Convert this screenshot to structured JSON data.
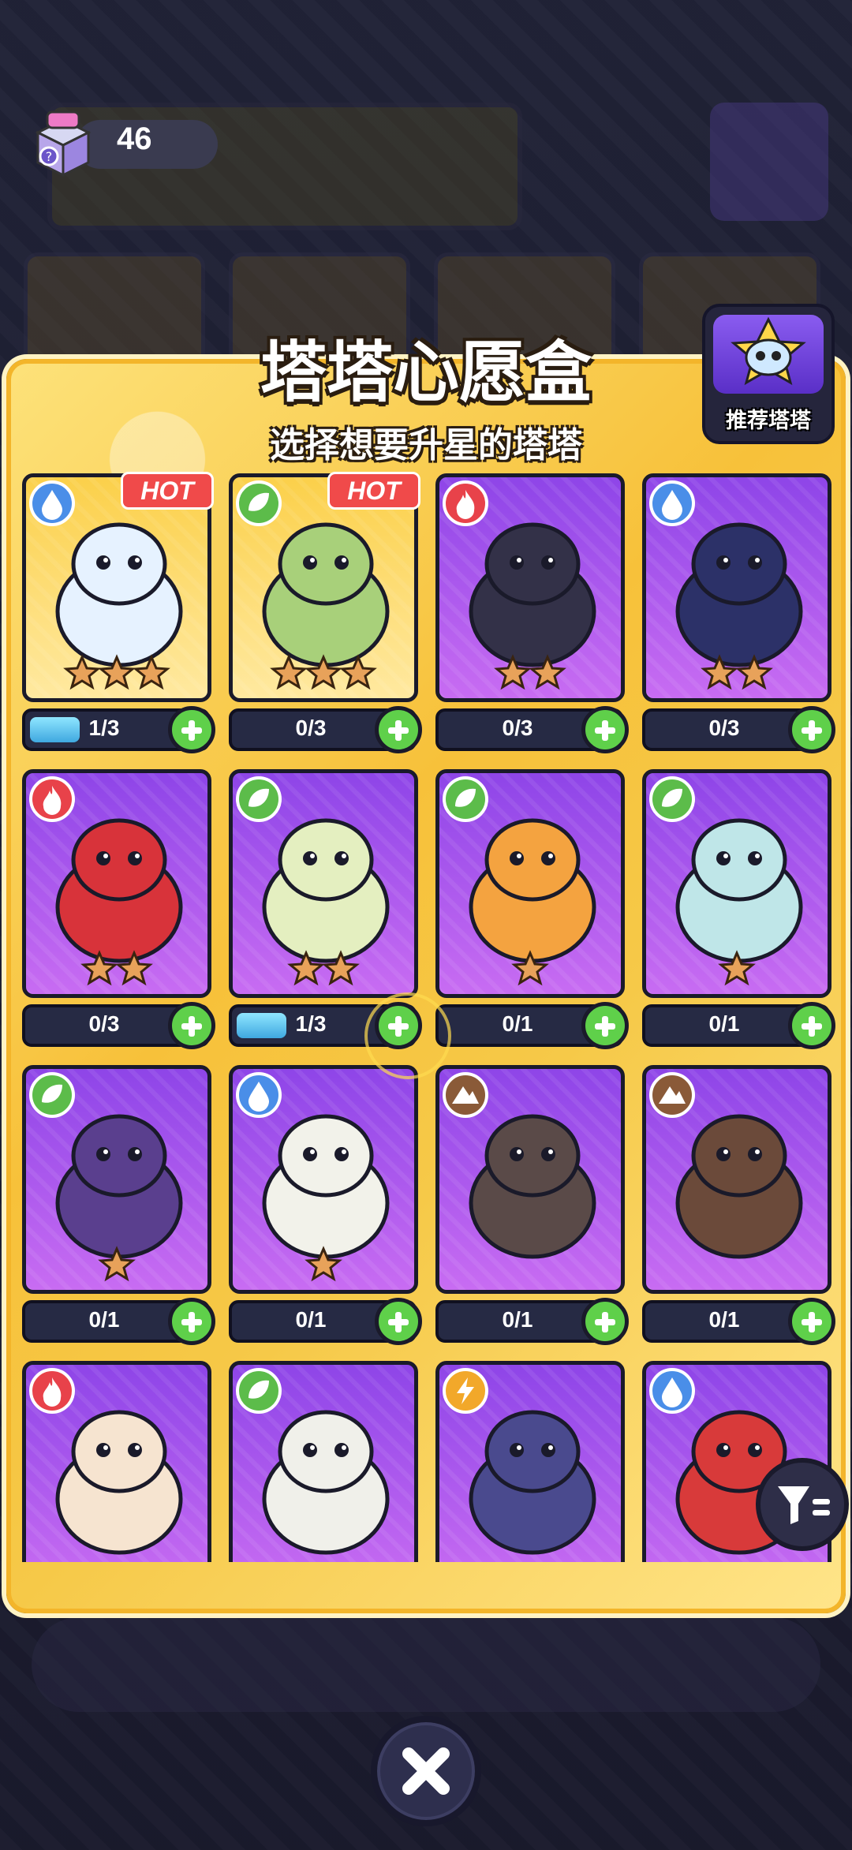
{
  "currency": {
    "value": "46",
    "icon": "gift-box-icon"
  },
  "panel": {
    "title": "塔塔心愿盒",
    "subtitle": "选择想要升星的塔塔",
    "recommend_label": "推荐塔塔"
  },
  "cards": [
    {
      "element": "water",
      "bg": "gold",
      "hot": true,
      "stars": 3,
      "progress": "1/3",
      "fill": 0.333,
      "creature": "blue-white-cat"
    },
    {
      "element": "grass",
      "bg": "gold",
      "hot": true,
      "stars": 3,
      "progress": "0/3",
      "fill": 0,
      "creature": "green-dragonfruit-cat"
    },
    {
      "element": "fire",
      "bg": "purple",
      "hot": false,
      "stars": 2,
      "progress": "0/3",
      "fill": 0,
      "creature": "dark-shiba-dog"
    },
    {
      "element": "water",
      "bg": "purple",
      "hot": false,
      "stars": 2,
      "progress": "0/3",
      "fill": 0,
      "creature": "rockhopper-penguin"
    },
    {
      "element": "fire",
      "bg": "purple",
      "hot": false,
      "stars": 2,
      "progress": "0/3",
      "fill": 0,
      "creature": "red-boxing-bird"
    },
    {
      "element": "grass",
      "bg": "purple",
      "hot": false,
      "stars": 2,
      "progress": "1/3",
      "fill": 0.333,
      "creature": "leaf-chicken"
    },
    {
      "element": "grass",
      "bg": "purple",
      "hot": false,
      "stars": 1,
      "progress": "0/1",
      "fill": 0,
      "creature": "sunflower"
    },
    {
      "element": "grass",
      "bg": "purple",
      "hot": false,
      "stars": 1,
      "progress": "0/1",
      "fill": 0,
      "creature": "slime-jar-bug"
    },
    {
      "element": "grass",
      "bg": "purple",
      "hot": false,
      "stars": 1,
      "progress": "0/1",
      "fill": 0,
      "creature": "mushroom"
    },
    {
      "element": "water",
      "bg": "purple",
      "hot": false,
      "stars": 1,
      "progress": "0/1",
      "fill": 0,
      "creature": "polar-bear"
    },
    {
      "element": "earth",
      "bg": "purple",
      "hot": false,
      "stars": 0,
      "progress": "0/1",
      "fill": 0,
      "creature": "rock-lizard"
    },
    {
      "element": "earth",
      "bg": "purple",
      "hot": false,
      "stars": 0,
      "progress": "0/1",
      "fill": 0,
      "creature": "sloth-monkey"
    },
    {
      "element": "fire",
      "bg": "purple",
      "hot": false,
      "stars": 0,
      "progress": "",
      "fill": 0,
      "creature": "fire-chick"
    },
    {
      "element": "grass",
      "bg": "purple",
      "hot": false,
      "stars": 0,
      "progress": "",
      "fill": 0,
      "creature": "panda"
    },
    {
      "element": "thunder",
      "bg": "purple",
      "hot": false,
      "stars": 0,
      "progress": "",
      "fill": 0,
      "creature": "thunder-rhino"
    },
    {
      "element": "water",
      "bg": "purple",
      "hot": false,
      "stars": 0,
      "progress": "",
      "fill": 0,
      "creature": "mushroom-frog"
    }
  ],
  "hot_label": "HOT",
  "colors": {
    "accent": "#f6c948",
    "plus": "#5fd04a",
    "hot": "#f04a4a"
  },
  "buttons": {
    "filter": "filter-icon",
    "close": "close-icon"
  }
}
